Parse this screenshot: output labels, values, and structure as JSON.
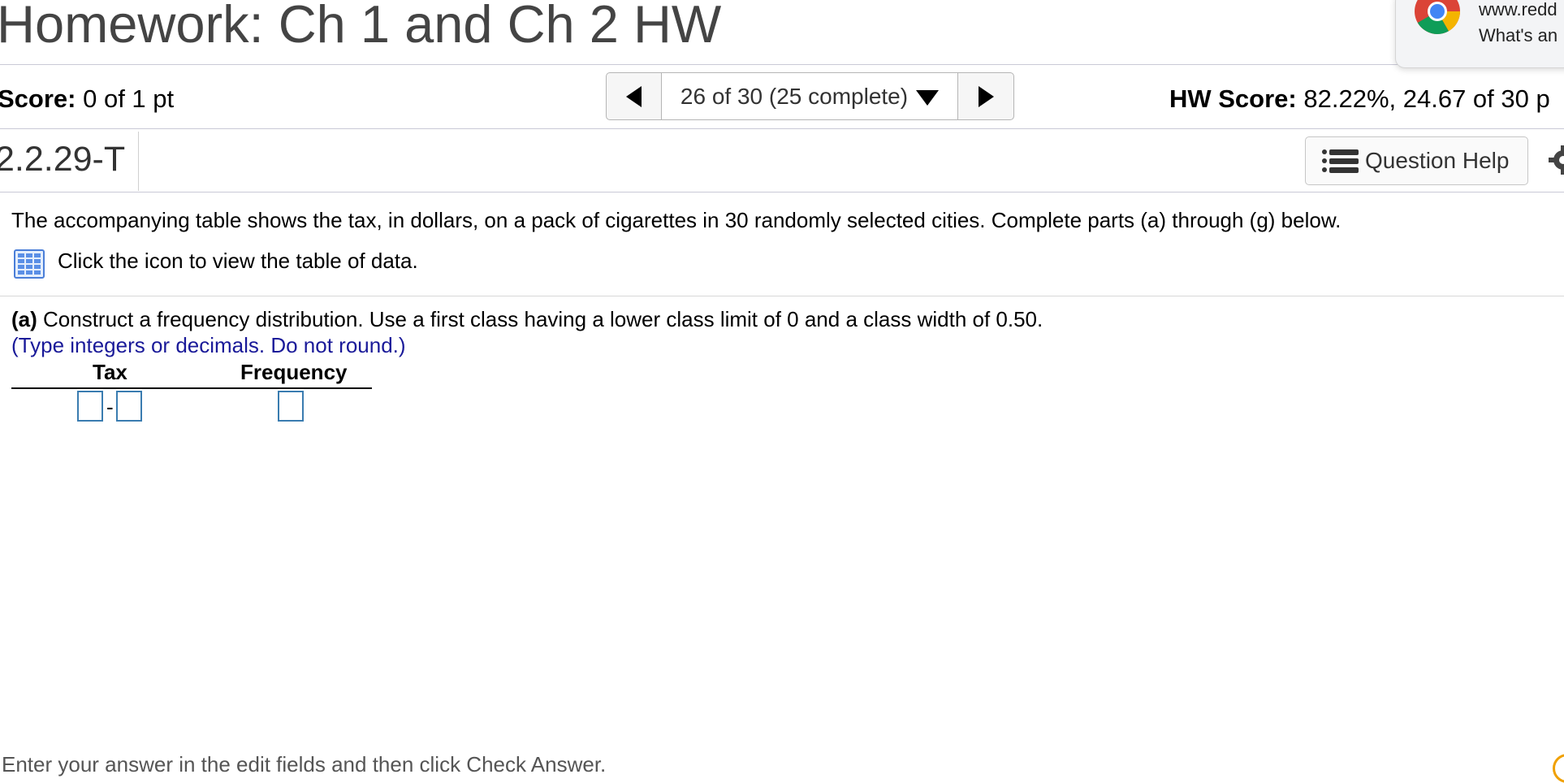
{
  "header": {
    "title": "Homework: Ch 1 and Ch 2 HW"
  },
  "score": {
    "label": "Score:",
    "value": "0 of 1 pt"
  },
  "nav": {
    "progress": "26 of 30 (25 complete)"
  },
  "hw_score": {
    "label": "HW Score:",
    "value": "82.22%, 24.67 of 30 p"
  },
  "question": {
    "id": "2.2.29-T",
    "help_label": "Question Help",
    "text": "The accompanying table shows the tax, in dollars, on a pack of cigarettes in 30 randomly selected cities. Complete parts (a) through (g) below.",
    "data_link_text": "Click the icon to view the table of data."
  },
  "part_a": {
    "label": "(a)",
    "text": "Construct a frequency distribution. Use a first class having a lower class limit of 0 and a class width of 0.50.",
    "instruction": "(Type integers or decimals. Do not round.)",
    "table": {
      "headers": [
        "Tax",
        "Frequency"
      ],
      "separator": "-",
      "rows": [
        {
          "tax_lower": "",
          "tax_upper": "",
          "frequency": ""
        }
      ]
    }
  },
  "footer": {
    "text": "Enter your answer in the edit fields and then click Check Answer."
  },
  "overlay": {
    "url": "www.redd",
    "subtitle": "What's an"
  },
  "colors": {
    "accent_blue": "#1a1a99",
    "input_border": "#3a7cb0",
    "icon_blue": "#4a7ed8"
  }
}
